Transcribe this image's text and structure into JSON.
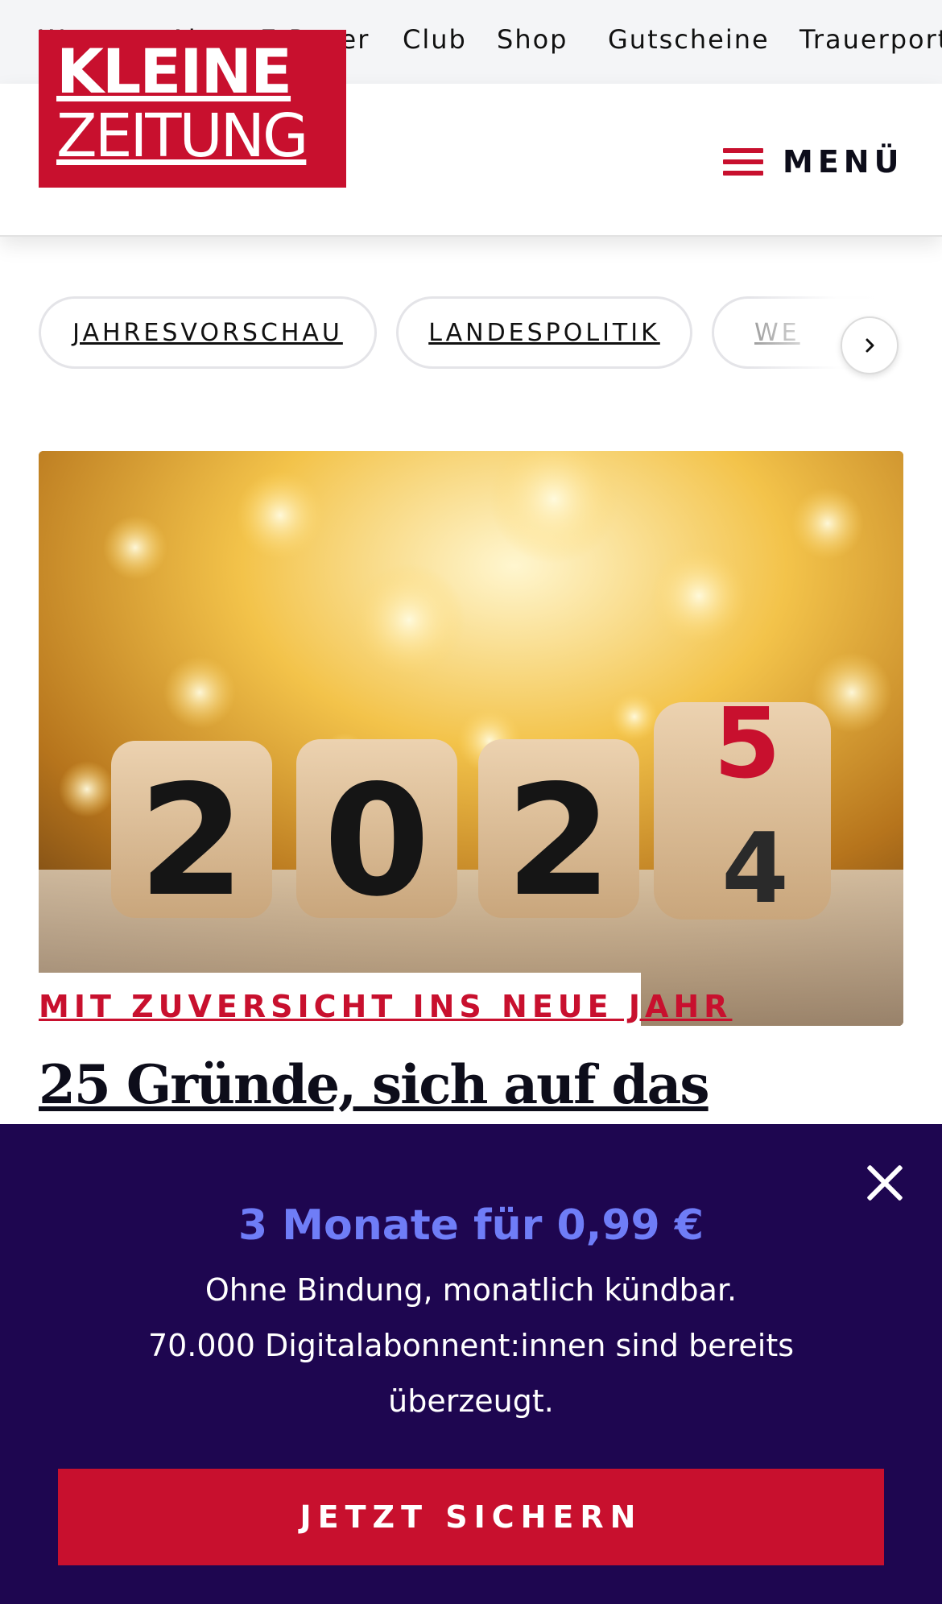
{
  "topnav": {
    "items": [
      "Wetter",
      "Abo",
      "E-Paper",
      "Club",
      "Shop",
      "Gutscheine",
      "Trauerportal"
    ]
  },
  "header": {
    "logo_line1": "KLEINE",
    "logo_line2": "ZEITUNG",
    "menu_label": "MENÜ",
    "menu_icon": "hamburger-icon",
    "accent_color": "#c8102e"
  },
  "chips": {
    "items": [
      "JAHRESVORSCHAU",
      "LANDESPOLITIK",
      "WE"
    ],
    "next_icon": "chevron-right-icon"
  },
  "article": {
    "image_dice": [
      "2",
      "0",
      "2",
      "4",
      "5"
    ],
    "kicker": "MIT ZUVERSICHT INS NEUE JAHR",
    "headline": "25 Gründe, sich auf das"
  },
  "offer": {
    "background_color": "#1e0650",
    "title": "3 Monate für 0,99 €",
    "line1": "Ohne Bindung, monatlich kündbar.",
    "line2": "70.000 Digitalabonnent:innen sind bereits",
    "line3": "überzeugt.",
    "cta_label": "JETZT SICHERN",
    "close_icon": "close-icon"
  }
}
